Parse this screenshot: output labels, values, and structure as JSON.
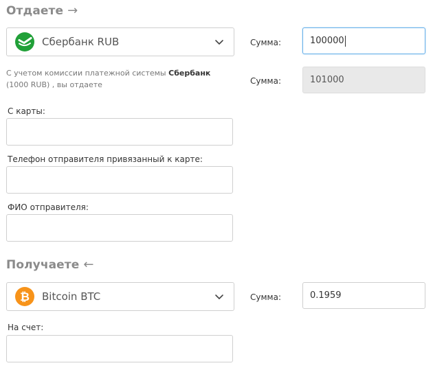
{
  "give": {
    "title": "Отдаете",
    "arrow": "→",
    "currency": {
      "label": "Сбербанк RUB",
      "icon": "sberbank-icon"
    },
    "sum_label": "Сумма:",
    "sum_value": "100000",
    "note_prefix": "С учетом комиссии платежной системы ",
    "note_bank": "Сбербанк",
    "note_suffix": " (1000 RUB) , вы отдаете",
    "total_label": "Сумма:",
    "total_value": "101000",
    "fields": [
      {
        "label": "С карты:",
        "value": ""
      },
      {
        "label": "Телефон отправителя привязанный к карте:",
        "value": ""
      },
      {
        "label": "ФИО отправителя:",
        "value": ""
      }
    ]
  },
  "receive": {
    "title": "Получаете",
    "arrow": "←",
    "currency": {
      "label": "Bitcoin BTC",
      "icon": "bitcoin-icon"
    },
    "sum_label": "Сумма:",
    "sum_value": "0.1959",
    "fields": [
      {
        "label": "На счет:",
        "value": ""
      }
    ]
  },
  "colors": {
    "sberbank_green": "#21a038",
    "bitcoin_orange": "#f7931a",
    "focus_blue": "#66afe9",
    "title_gray": "#8a8a8a"
  }
}
